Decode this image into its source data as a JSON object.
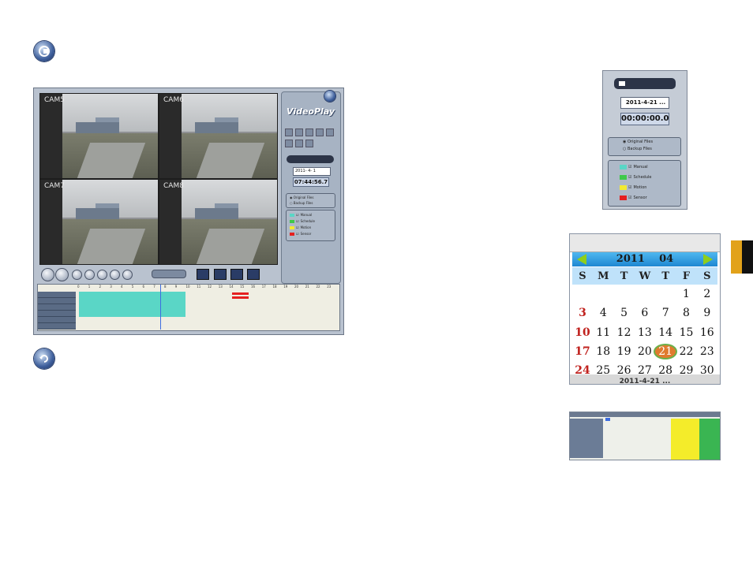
{
  "main_window": {
    "cameras": [
      {
        "label": "CAM5"
      },
      {
        "label": "CAM6"
      },
      {
        "label": "CAM7"
      },
      {
        "label": "CAM8"
      }
    ],
    "panel_logo": "VideoPlay",
    "date_value": "2011- 4- 1",
    "time_value": "07:44:56.7",
    "file_options": [
      "Original Files",
      "Backup Files"
    ],
    "legend": [
      {
        "label": "Manual",
        "color": "#5ad6c6"
      },
      {
        "label": "Schedule",
        "color": "#3fc94a"
      },
      {
        "label": "Motion",
        "color": "#f2ea33"
      },
      {
        "label": "Sensor",
        "color": "#e52020"
      }
    ],
    "timeline_hours": [
      "0",
      "1",
      "2",
      "3",
      "4",
      "5",
      "6",
      "7",
      "8",
      "9",
      "10",
      "11",
      "12",
      "13",
      "14",
      "15",
      "16",
      "17",
      "18",
      "19",
      "20",
      "21",
      "22",
      "23"
    ]
  },
  "snippet_playback": {
    "date_value": "2011-4-21 ...",
    "time_value": "00:00:00.0",
    "file_options": [
      "Original Files",
      "Backup Files"
    ],
    "legend": [
      {
        "label": "Manual",
        "color": "#5ad6c6"
      },
      {
        "label": "Schedule",
        "color": "#3fc94a"
      },
      {
        "label": "Motion",
        "color": "#f2ea33"
      },
      {
        "label": "Sensor",
        "color": "#e52020"
      }
    ]
  },
  "calendar": {
    "year": "2011",
    "month": "04",
    "weekdays": [
      "S",
      "M",
      "T",
      "W",
      "T",
      "F",
      "S"
    ],
    "selected_day": "21",
    "footer_text": "2011-4-21 ..."
  },
  "colors": {
    "accent_blue": "#1e87d1",
    "nav_arrow": "#8fce1b",
    "selected_day_bg": "#e07b2e",
    "tab_orange": "#e2a21a"
  }
}
